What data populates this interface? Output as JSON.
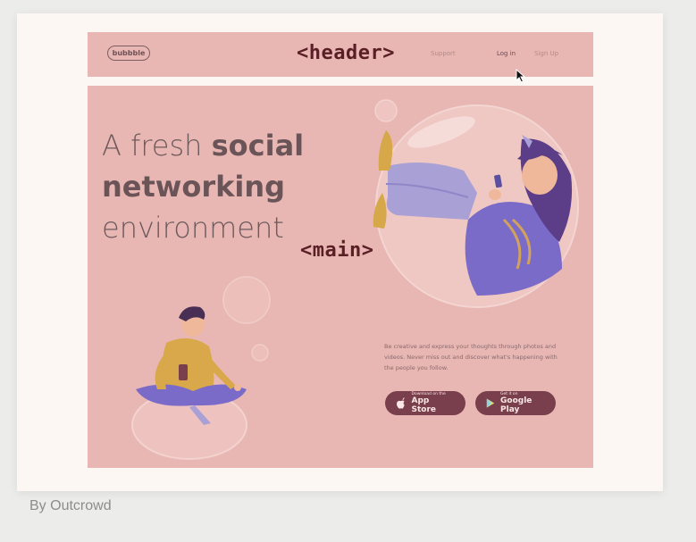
{
  "header": {
    "logo": "bubbble",
    "tag": "<header>",
    "nav": {
      "support": "Support",
      "login": "Log in",
      "signup": "Sign Up"
    }
  },
  "main": {
    "tag": "<main>",
    "headline": {
      "line1_light": "A fresh ",
      "line1_bold": "social",
      "line2_bold": "networking",
      "line3_light": "environment"
    },
    "copy": {
      "line1": "Be creative and express your thoughts through photos and",
      "line2": "videos. Never miss out and discover what's happening with",
      "line3": "the people you follow."
    },
    "app_store": {
      "small": "Download on the",
      "big": "App Store"
    },
    "google_play": {
      "small": "Get it on",
      "big": "Google Play"
    }
  },
  "credit": "By Outcrowd",
  "colors": {
    "section_bg": "#e8b7b3",
    "card_bg": "#fcf7f3",
    "button_bg": "#7a3f4c",
    "tag_color": "#5a1f25"
  }
}
